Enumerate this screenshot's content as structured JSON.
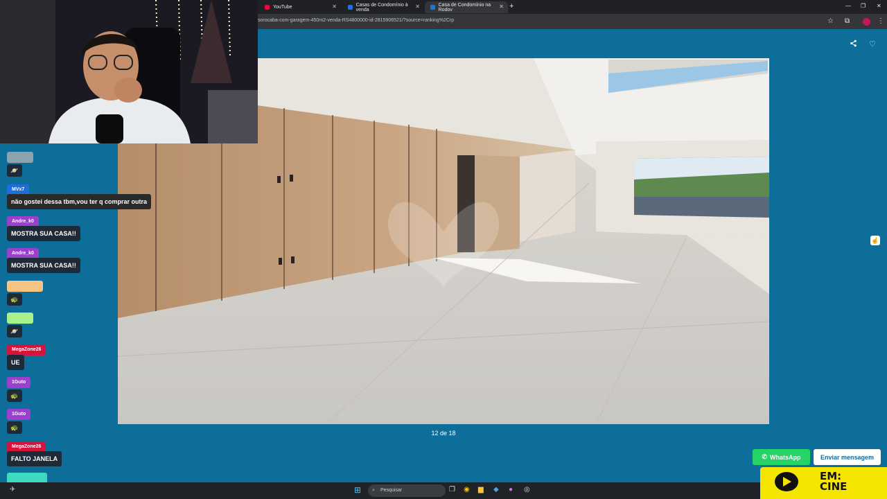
{
  "browser": {
    "tabs": [
      {
        "title": "YouTube",
        "fav": "#ff0033"
      },
      {
        "title": "Casas de Condomínio à venda",
        "fav": "#1a73e8"
      },
      {
        "title": "Casa de Condomínio na Rodov",
        "fav": "#1a73e8"
      }
    ],
    "url": "sorocaba-com-garagem-450m2-venda-RS4800000-id-2815906521/?source=ranking%2Crp"
  },
  "gallery": {
    "counter": "12 de 18"
  },
  "actions": {
    "whatsapp_label": "WhatsApp",
    "message_label": "Enviar mensagem"
  },
  "logo": {
    "line1": "EM:",
    "line2": "CINE"
  },
  "chat": {
    "messages": [
      {
        "user": "MVx7",
        "text": "não gostei dessa tbm,vou ter q comprar outra"
      },
      {
        "user": "Andre_k0",
        "text": "MOSTRA SUA CASA!!"
      },
      {
        "user": "Andre_k0",
        "text": "MOSTRA SUA CASA!!"
      },
      {
        "user": "MegaZone26",
        "text": "UE"
      },
      {
        "user": "1Guto",
        "text": ""
      },
      {
        "user": "1Guto",
        "text": ""
      },
      {
        "user": "MegaZone26",
        "text": "FALTO JANELA"
      }
    ]
  },
  "taskbar": {
    "search_placeholder": "Pesquisar"
  }
}
